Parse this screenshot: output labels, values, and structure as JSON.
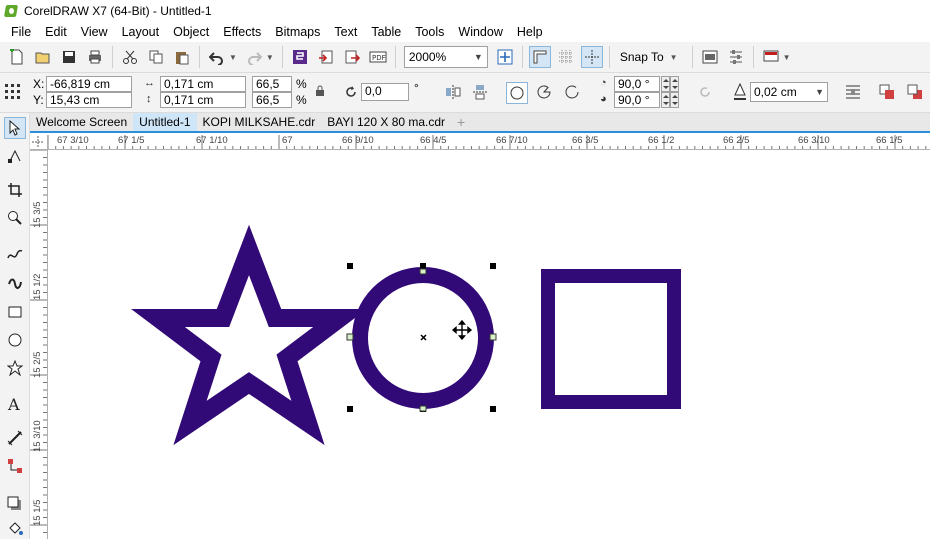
{
  "window": {
    "title": "CorelDRAW X7 (64-Bit) - Untitled-1",
    "icon": "coreldraw-logo-icon"
  },
  "menu": [
    {
      "label": "File",
      "name": "menu-file"
    },
    {
      "label": "Edit",
      "name": "menu-edit"
    },
    {
      "label": "View",
      "name": "menu-view"
    },
    {
      "label": "Layout",
      "name": "menu-layout"
    },
    {
      "label": "Object",
      "name": "menu-object"
    },
    {
      "label": "Effects",
      "name": "menu-effects"
    },
    {
      "label": "Bitmaps",
      "name": "menu-bitmaps"
    },
    {
      "label": "Text",
      "name": "menu-text"
    },
    {
      "label": "Table",
      "name": "menu-table"
    },
    {
      "label": "Tools",
      "name": "menu-tools"
    },
    {
      "label": "Window",
      "name": "menu-window"
    },
    {
      "label": "Help",
      "name": "menu-help"
    }
  ],
  "standard_toolbar": {
    "zoom_level": "2000%",
    "snap_to_label": "Snap To"
  },
  "property_bar": {
    "x_label": "X:",
    "y_label": "Y:",
    "x_value": "-66,819 cm",
    "y_value": "15,43 cm",
    "width_value": "0,171 cm",
    "height_value": "0,171 cm",
    "scale_x": "66,5",
    "scale_y": "66,5",
    "percent_symbol": "%",
    "rotation_value": "0,0",
    "degree_symbol": "°",
    "start_angle": "90,0 °",
    "end_angle": "90,0 °",
    "outline_width": "0,02 cm"
  },
  "document_tabs": [
    {
      "label": "Welcome Screen",
      "active": false
    },
    {
      "label": "Untitled-1",
      "active": true
    },
    {
      "label": "KOPI MILKSAHE.cdr",
      "active": false
    },
    {
      "label": "BAYI 120 X 80 ma.cdr",
      "active": false
    }
  ],
  "rulers": {
    "horizontal": [
      "67 3/10",
      "67 1/5",
      "67 1/10",
      "67",
      "66 9/10",
      "66 4/5",
      "66 7/10",
      "66 3/5",
      "66 1/2",
      "66 2/5",
      "66 3/10",
      "66 1/5"
    ],
    "vertical": [
      "15 3/5",
      "15 1/2",
      "15 2/5",
      "15 3/10",
      "15 1/5"
    ]
  },
  "colors": {
    "shape_fill": "#320a78",
    "tab_accent": "#2a8fd8",
    "toolbar_bg": "#f3f3f3"
  }
}
